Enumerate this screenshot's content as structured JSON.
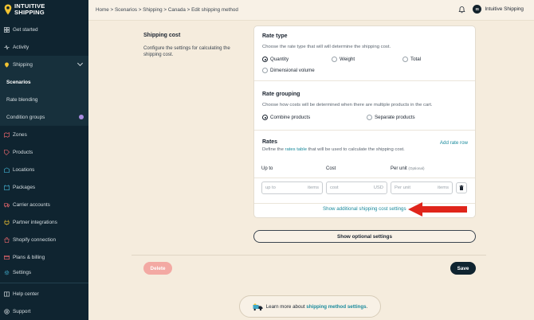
{
  "app": {
    "logo_line1": "INTUITIVE",
    "logo_line2": "SHIPPING"
  },
  "sidebar": {
    "items": [
      {
        "label": "Get started"
      },
      {
        "label": "Activity"
      },
      {
        "label": "Shipping"
      },
      {
        "label": "Scenarios"
      },
      {
        "label": "Rate blending"
      },
      {
        "label": "Condition groups"
      },
      {
        "label": "Zones"
      },
      {
        "label": "Products"
      },
      {
        "label": "Locations"
      },
      {
        "label": "Packages"
      },
      {
        "label": "Carrier accounts"
      },
      {
        "label": "Partner integrations"
      },
      {
        "label": "Shopify connection"
      },
      {
        "label": "Plans & billing"
      },
      {
        "label": "Settings"
      },
      {
        "label": "Help center"
      },
      {
        "label": "Support"
      }
    ]
  },
  "header": {
    "breadcrumb": "Home > Scenarios > Shipping > Canada > Edit shipping method",
    "user_initials": "IS",
    "user_name": "Intuitive Shipping"
  },
  "section": {
    "title": "Shipping cost",
    "description": "Configure the settings for calculating the shipping cost."
  },
  "rate_type": {
    "title": "Rate type",
    "description": "Choose the rate type that will will determine the shipping cost.",
    "options": [
      "Quantity",
      "Weight",
      "Total",
      "Dimensional volume"
    ],
    "selected": "Quantity"
  },
  "rate_grouping": {
    "title": "Rate grouping",
    "description": "Choose how costs will be determined when there are multiple products in the cart.",
    "options": [
      "Combine products",
      "Separate products"
    ],
    "selected": "Combine products"
  },
  "rates": {
    "title": "Rates",
    "add_label": "Add rate row",
    "desc_before": "Define the ",
    "desc_link": "rates table",
    "desc_after": " that will be used to calculate the shipping cost.",
    "col_upto": "Up to",
    "col_cost": "Cost",
    "col_perunit": "Per unit",
    "col_perunit_note": "(Optional)",
    "row": {
      "upto_placeholder": "up to",
      "upto_suffix": "items",
      "cost_placeholder": "cost",
      "cost_suffix": "USD",
      "perunit_placeholder": "Per unit",
      "perunit_suffix": "items"
    },
    "additional_link": "Show additional shipping cost settings"
  },
  "buttons": {
    "optional": "Show optional settings",
    "delete": "Delete",
    "save": "Save"
  },
  "learn": {
    "before": "Learn more about ",
    "link": "shipping method settings",
    "after": "."
  },
  "colors": {
    "sidebar": "#0f2430",
    "accent": "#1a8a9c",
    "arrow": "#e0251b",
    "delete": "#f3a9a3"
  }
}
